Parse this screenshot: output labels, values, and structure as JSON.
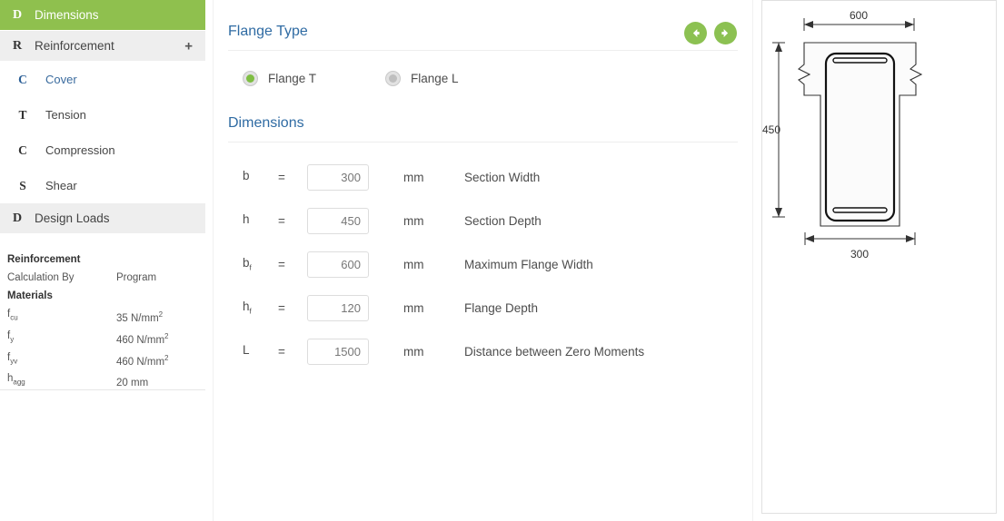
{
  "sidebar": {
    "nav": [
      {
        "letter": "D",
        "label": "Dimensions",
        "state": "active",
        "plus": ""
      },
      {
        "letter": "R",
        "label": "Reinforcement",
        "state": "top",
        "plus": "+"
      }
    ],
    "sub_items": [
      {
        "letter": "C",
        "label": "Cover",
        "selected": true
      },
      {
        "letter": "T",
        "label": "Tension",
        "selected": false
      },
      {
        "letter": "C",
        "label": "Compression",
        "selected": false
      },
      {
        "letter": "S",
        "label": "Shear",
        "selected": false
      }
    ],
    "design_loads": {
      "letter": "D",
      "label": "Design Loads"
    },
    "summary": {
      "heading_reinforcement": "Reinforcement",
      "calculation_by_label": "Calculation By",
      "calculation_by_value": "Program",
      "heading_materials": "Materials",
      "rows": [
        {
          "key_base": "f",
          "key_sub": "cu",
          "value": "35 N/mm",
          "value_sup": "2"
        },
        {
          "key_base": "f",
          "key_sub": "y",
          "value": "460 N/mm",
          "value_sup": "2"
        },
        {
          "key_base": "f",
          "key_sub": "yv",
          "value": "460 N/mm",
          "value_sup": "2"
        },
        {
          "key_base": "h",
          "key_sub": "agg",
          "value": "20 mm",
          "value_sup": ""
        }
      ]
    }
  },
  "main": {
    "flange_type_heading": "Flange Type",
    "dimensions_heading": "Dimensions",
    "radio_options": [
      {
        "label": "Flange T",
        "checked": true
      },
      {
        "label": "Flange L",
        "checked": false
      }
    ],
    "nav_prev_icon": "arrow-left-circle-icon",
    "nav_next_icon": "arrow-right-circle-icon",
    "equals": "=",
    "rows": [
      {
        "sym_base": "b",
        "sym_sub": "",
        "value": "300",
        "unit": "mm",
        "desc": "Section Width"
      },
      {
        "sym_base": "h",
        "sym_sub": "",
        "value": "450",
        "unit": "mm",
        "desc": "Section Depth"
      },
      {
        "sym_base": "b",
        "sym_sub": "f",
        "value": "600",
        "unit": "mm",
        "desc": "Maximum Flange Width"
      },
      {
        "sym_base": "h",
        "sym_sub": "f",
        "value": "120",
        "unit": "mm",
        "desc": "Flange Depth"
      },
      {
        "sym_base": "L",
        "sym_sub": "",
        "value": "1500",
        "unit": "mm",
        "desc": "Distance between Zero Moments"
      }
    ]
  },
  "drawing": {
    "type": "flanged-t-section-cross-section",
    "dim_top": "600",
    "dim_left": "450",
    "dim_bottom": "300"
  },
  "colors": {
    "accent_green": "#8cc152",
    "heading_blue": "#2f6ba3",
    "sidebar_grey": "#eeeeee"
  }
}
